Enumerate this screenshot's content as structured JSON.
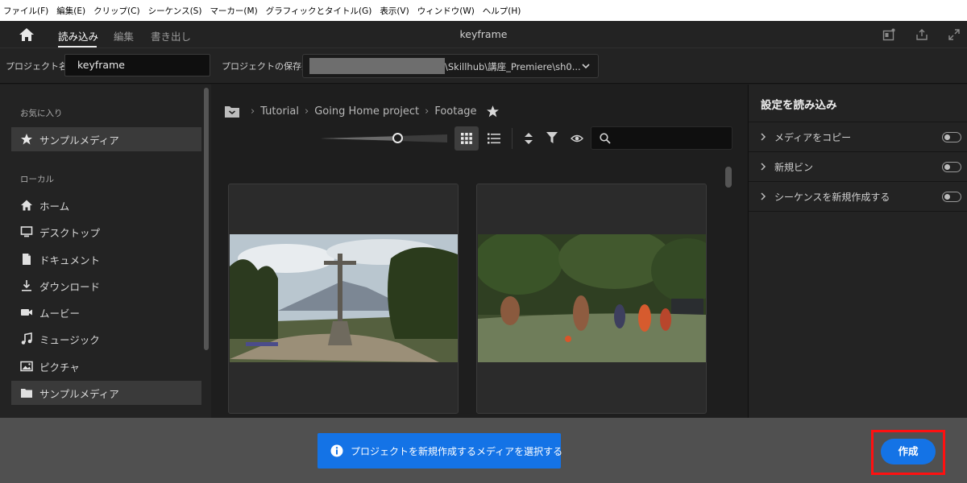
{
  "menu": [
    "ファイル(F)",
    "編集(E)",
    "クリップ(C)",
    "シーケンス(S)",
    "マーカー(M)",
    "グラフィックとタイトル(G)",
    "表示(V)",
    "ウィンドウ(W)",
    "ヘルプ(H)"
  ],
  "header": {
    "tabs": [
      "読み込み",
      "編集",
      "書き出し"
    ],
    "active_tab": "読み込み",
    "title": "keyframe"
  },
  "project": {
    "name_label": "プロジェクト名",
    "name_value": "keyframe",
    "location_label": "プロジェクトの保存先",
    "location_value": "\\Skillhub\\講座_Premiere\\sh0..."
  },
  "sidebar": {
    "favorites_heading": "お気に入り",
    "favorites": [
      {
        "label": "サンプルメディア",
        "icon": "star-icon"
      }
    ],
    "local_heading": "ローカル",
    "local": [
      {
        "label": "ホーム",
        "icon": "home-icon"
      },
      {
        "label": "デスクトップ",
        "icon": "monitor-icon"
      },
      {
        "label": "ドキュメント",
        "icon": "document-icon"
      },
      {
        "label": "ダウンロード",
        "icon": "download-icon"
      },
      {
        "label": "ムービー",
        "icon": "video-camera-icon"
      },
      {
        "label": "ミュージック",
        "icon": "music-note-icon"
      },
      {
        "label": "ピクチャ",
        "icon": "picture-icon"
      },
      {
        "label": "サンプルメディア",
        "icon": "folder-icon"
      }
    ]
  },
  "browser": {
    "breadcrumb": [
      "Tutorial",
      "Going Home project",
      "Footage"
    ],
    "view_mode": "grid",
    "search_placeholder": "",
    "clips": [
      {
        "thumbnail": "cross-on-hill"
      },
      {
        "thumbnail": "kids-playing-football"
      }
    ]
  },
  "import_settings": {
    "title": "設定を読み込み",
    "options": [
      {
        "label": "メディアをコピー",
        "enabled": false
      },
      {
        "label": "新規ビン",
        "enabled": false
      },
      {
        "label": "シーケンスを新規作成する",
        "enabled": false
      }
    ]
  },
  "footer": {
    "info_message": "プロジェクトを新規作成するメディアを選択する",
    "create_label": "作成"
  },
  "colors": {
    "accent": "#1473e6",
    "highlight": "#ff1010",
    "footer_bg": "#505050"
  }
}
